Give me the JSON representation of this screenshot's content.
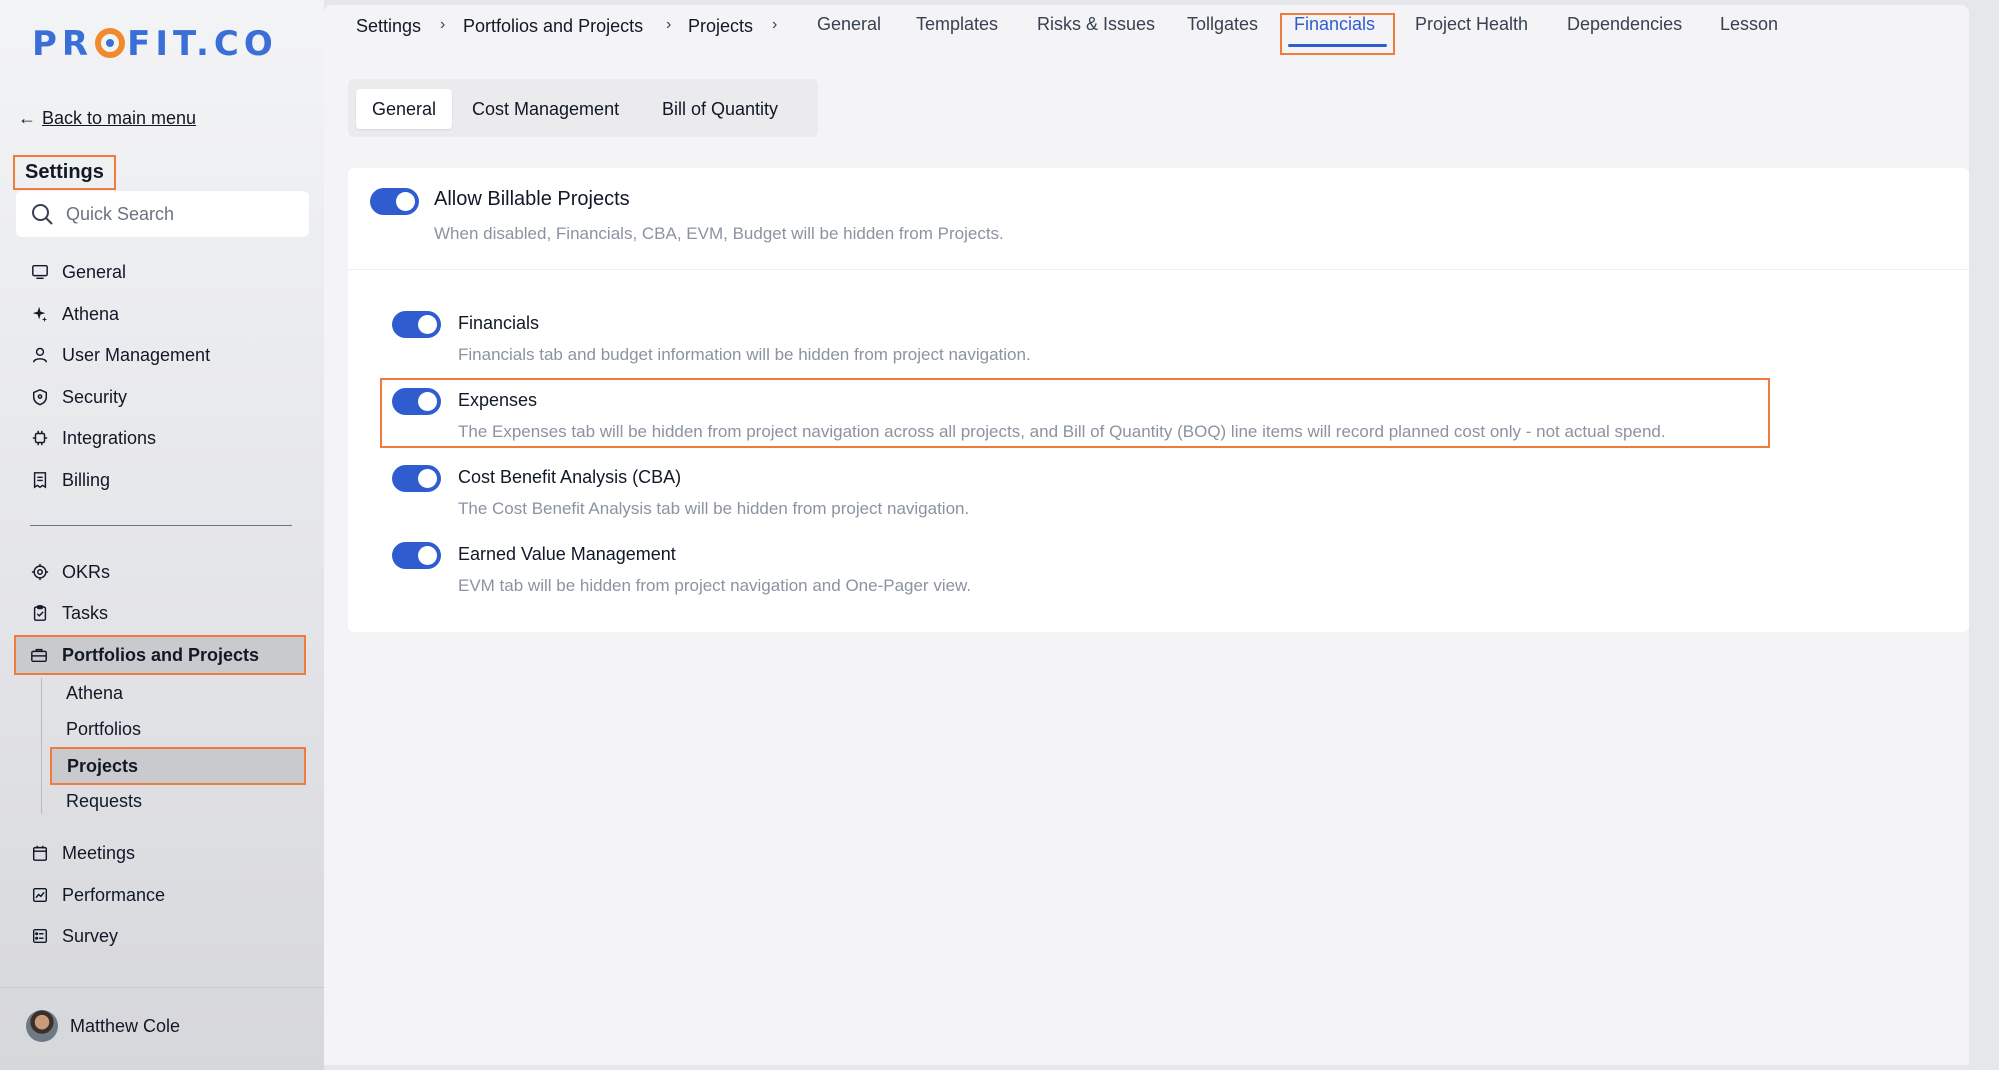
{
  "brand": {
    "logo_prefix": "PR",
    "logo_suffix": "FIT.CO"
  },
  "sidebar": {
    "back_link": "Back to main menu",
    "settings_title": "Settings",
    "search_placeholder": "Quick Search",
    "items_top": [
      {
        "label": "General",
        "icon": "monitor-icon"
      },
      {
        "label": "Athena",
        "icon": "sparkle-icon"
      },
      {
        "label": "User Management",
        "icon": "user-icon"
      },
      {
        "label": "Security",
        "icon": "shield-icon"
      },
      {
        "label": "Integrations",
        "icon": "chip-icon"
      },
      {
        "label": "Billing",
        "icon": "receipt-icon"
      }
    ],
    "items_bottom": [
      {
        "label": "OKRs",
        "icon": "target-icon"
      },
      {
        "label": "Tasks",
        "icon": "clipboard-check-icon"
      }
    ],
    "active_item": {
      "label": "Portfolios and Projects",
      "icon": "briefcase-icon"
    },
    "sub_items": [
      "Athena",
      "Portfolios",
      "Projects",
      "Requests"
    ],
    "active_sub_item": "Projects",
    "items_after": [
      {
        "label": "Meetings",
        "icon": "calendar-icon"
      },
      {
        "label": "Performance",
        "icon": "chart-line-icon"
      },
      {
        "label": "Survey",
        "icon": "survey-icon"
      }
    ],
    "user_name": "Matthew Cole"
  },
  "breadcrumb": [
    "Settings",
    "Portfolios and Projects",
    "Projects"
  ],
  "top_tabs": [
    "General",
    "Templates",
    "Risks & Issues",
    "Tollgates",
    "Financials",
    "Project Health",
    "Dependencies",
    "Lesson"
  ],
  "active_top_tab": "Financials",
  "sub_tabs": [
    "General",
    "Cost Management",
    "Bill of Quantity"
  ],
  "active_sub_tab": "General",
  "master_option": {
    "title": "Allow Billable Projects",
    "description": "When disabled, Financials, CBA, EVM, Budget will be hidden from Projects.",
    "enabled": true
  },
  "options": [
    {
      "title": "Financials",
      "description": "Financials tab and budget information will be hidden from project navigation.",
      "enabled": true
    },
    {
      "title": "Expenses",
      "description": "The Expenses tab will be hidden from project navigation across all projects, and Bill of Quantity (BOQ) line items will record planned cost only - not actual spend.",
      "enabled": true
    },
    {
      "title": "Cost Benefit Analysis (CBA)",
      "description": "The Cost Benefit Analysis tab will be hidden from project navigation.",
      "enabled": true
    },
    {
      "title": "Earned Value Management",
      "description": "EVM tab will be hidden from project navigation and One-Pager view.",
      "enabled": true
    }
  ],
  "colors": {
    "accent": "#2f5ccf",
    "highlight": "#f07b3f",
    "logo_blue": "#3a6fd8",
    "logo_orange": "#f08a2c"
  }
}
